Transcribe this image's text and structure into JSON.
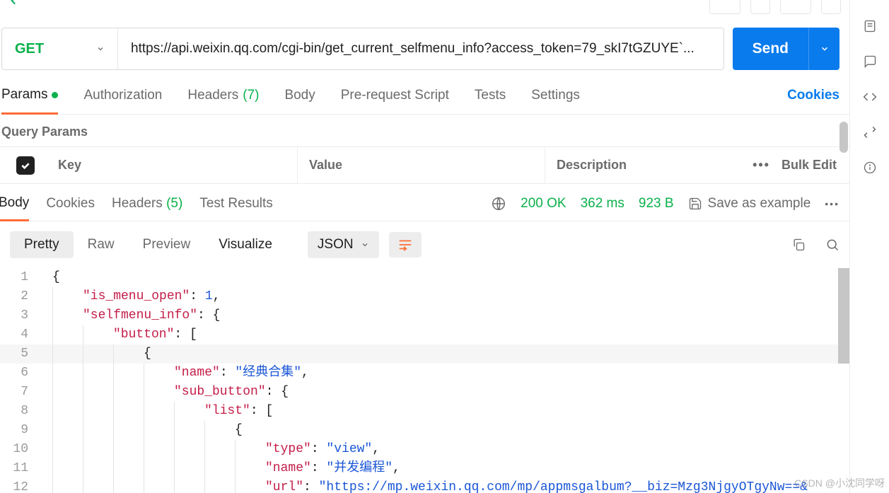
{
  "request": {
    "method": "GET",
    "url": "https://api.weixin.qq.com/cgi-bin/get_current_selfmenu_info?access_token=79_skI7tGZUYE`...",
    "sendLabel": "Send"
  },
  "reqTabs": {
    "params": "Params",
    "authorization": "Authorization",
    "headers": "Headers",
    "headersCount": "(7)",
    "body": "Body",
    "prerequest": "Pre-request Script",
    "tests": "Tests",
    "settings": "Settings",
    "cookies": "Cookies"
  },
  "queryParams": {
    "title": "Query Params",
    "keyHeader": "Key",
    "valueHeader": "Value",
    "descHeader": "Description",
    "bulkEdit": "Bulk Edit"
  },
  "respTabs": {
    "body": "Body",
    "cookies": "Cookies",
    "headers": "Headers",
    "headersCount": "(5)",
    "testResults": "Test Results"
  },
  "respMeta": {
    "status": "200 OK",
    "time": "362 ms",
    "size": "923 B",
    "saveExample": "Save as example"
  },
  "bodyView": {
    "pretty": "Pretty",
    "raw": "Raw",
    "preview": "Preview",
    "visualize": "Visualize",
    "format": "JSON"
  },
  "codeLines": [
    {
      "n": "1",
      "indent": 0,
      "tokens": [
        [
          "brace",
          "{"
        ]
      ]
    },
    {
      "n": "2",
      "indent": 1,
      "tokens": [
        [
          "key",
          "\"is_menu_open\""
        ],
        [
          "punc",
          ": "
        ],
        [
          "num",
          "1"
        ],
        [
          "punc",
          ","
        ]
      ]
    },
    {
      "n": "3",
      "indent": 1,
      "tokens": [
        [
          "key",
          "\"selfmenu_info\""
        ],
        [
          "punc",
          ": "
        ],
        [
          "brace",
          "{"
        ]
      ]
    },
    {
      "n": "4",
      "indent": 2,
      "tokens": [
        [
          "key",
          "\"button\""
        ],
        [
          "punc",
          ": "
        ],
        [
          "brace",
          "["
        ]
      ]
    },
    {
      "n": "5",
      "indent": 3,
      "hl": true,
      "tokens": [
        [
          "brace",
          "{"
        ]
      ]
    },
    {
      "n": "6",
      "indent": 4,
      "tokens": [
        [
          "key",
          "\"name\""
        ],
        [
          "punc",
          ": "
        ],
        [
          "str",
          "\"经典合集\""
        ],
        [
          "punc",
          ","
        ]
      ]
    },
    {
      "n": "7",
      "indent": 4,
      "tokens": [
        [
          "key",
          "\"sub_button\""
        ],
        [
          "punc",
          ": "
        ],
        [
          "brace",
          "{"
        ]
      ]
    },
    {
      "n": "8",
      "indent": 5,
      "tokens": [
        [
          "key",
          "\"list\""
        ],
        [
          "punc",
          ": "
        ],
        [
          "brace",
          "["
        ]
      ]
    },
    {
      "n": "9",
      "indent": 6,
      "tokens": [
        [
          "brace",
          "{"
        ]
      ]
    },
    {
      "n": "10",
      "indent": 7,
      "tokens": [
        [
          "key",
          "\"type\""
        ],
        [
          "punc",
          ": "
        ],
        [
          "str",
          "\"view\""
        ],
        [
          "punc",
          ","
        ]
      ]
    },
    {
      "n": "11",
      "indent": 7,
      "tokens": [
        [
          "key",
          "\"name\""
        ],
        [
          "punc",
          ": "
        ],
        [
          "str",
          "\"并发编程\""
        ],
        [
          "punc",
          ","
        ]
      ]
    },
    {
      "n": "12",
      "indent": 7,
      "tokens": [
        [
          "key",
          "\"url\""
        ],
        [
          "punc",
          ": "
        ],
        [
          "str",
          "\"https://mp.weixin.qq.com/mp/appmsgalbum?__biz=Mzg3NjgyOTgyNw==&"
        ]
      ]
    }
  ],
  "watermark": "CSDN @小沈同学呀"
}
